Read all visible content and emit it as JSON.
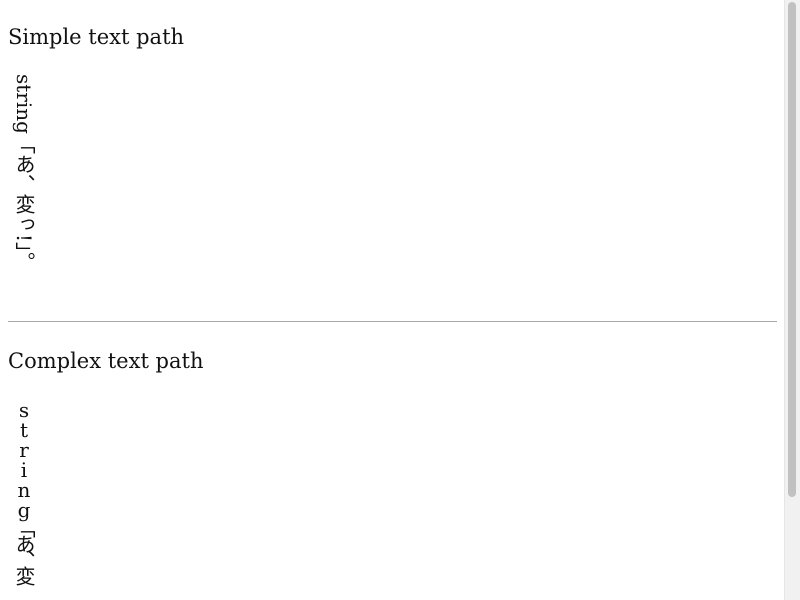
{
  "sections": {
    "simple": {
      "title": "Simple text path",
      "vertical_text": "string「あ、変っ!」。"
    },
    "complex": {
      "title": "Complex text path",
      "vertical_text": "string「あ、変"
    }
  },
  "scrollbar": {
    "thumb_position_fraction": 0.0,
    "visible_fraction": 0.83
  }
}
